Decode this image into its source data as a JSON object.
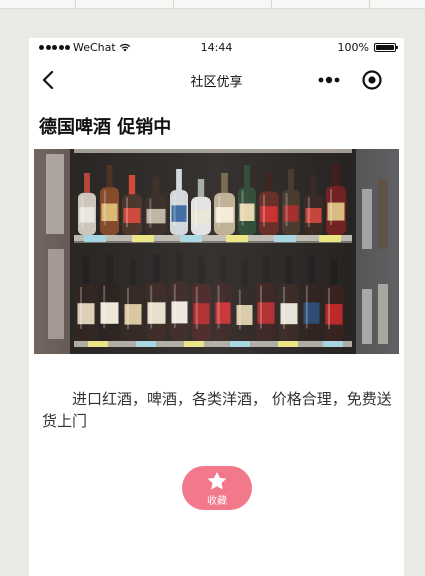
{
  "status_bar": {
    "carrier": "WeChat",
    "time": "14:44",
    "battery": "100%",
    "battery_level": 1.0
  },
  "nav": {
    "title": "社区优享",
    "back_icon": "chevron-left-icon",
    "more_icon": "more-dots-icon",
    "close_icon": "target-close-icon"
  },
  "page": {
    "title": "德国啤酒 促销中",
    "hero_image": "liquor-store-shelf-photo",
    "description": "进口红酒，啤酒，各类洋酒， 价格合理，免费送货上门"
  },
  "favorite": {
    "label": "收藏",
    "icon": "star-icon",
    "color": "#f1798b"
  }
}
